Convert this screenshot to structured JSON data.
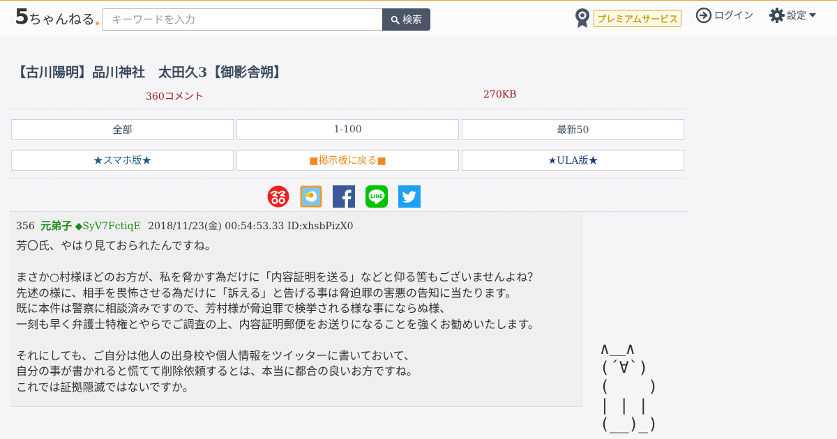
{
  "header": {
    "logo_five": "5",
    "logo_rest": "ちゃんねる",
    "search_placeholder": "キーワードを入力",
    "search_button": "検索",
    "premium": "プレミアムサービス",
    "login": "ログイン",
    "settings": "設定"
  },
  "thread": {
    "title": "【古川陽明】品川神社　太田久3【御影舎朔】",
    "comments": "360コメント",
    "size": "270KB"
  },
  "nav_buttons": [
    {
      "label": "全部",
      "color": "#3c4a5e"
    },
    {
      "label": "1-100",
      "color": "#3c4a5e"
    },
    {
      "label": "最新50",
      "color": "#3c4a5e"
    }
  ],
  "link_buttons": [
    {
      "label": "★スマホ版★",
      "color": "#1f5e8c"
    },
    {
      "label": "■掲示板に戻る■",
      "color": "#f0891a"
    },
    {
      "label": "★ULA版★",
      "color": "#1f3f7a"
    }
  ],
  "share_icons": [
    "zzz-icon",
    "gift-icon",
    "facebook-icon",
    "line-icon",
    "twitter-icon"
  ],
  "post": {
    "number": "356",
    "name": "元弟子",
    "trip": "◆SyV7FctiqE",
    "date": "2018/11/23(金) 00:54:53.33",
    "id": "ID:xhsbPizX0",
    "body": "芳〇氏、やはり見ておられたんですね。\n\nまさか○村様ほどのお方が、私を脅かす為だけに「内容証明を送る」などと仰る筈もございませんよね？\n先述の様に、相手を畏怖させる為だけに「訴える」と告げる事は脅迫罪の害悪の告知に当たります。\n既に本件は警察に相談済みですので、芳村様が脅迫罪で検挙される様な事にならぬ様、\n一刻も早く弁護士特権とやらでご調査の上、内容証明郵便をお送りになることを強くお勧めいたします。\n\nそれにしても、ご自分は他人の出身校や個人情報をツイッターに書いておいて、\n自分の事が書かれると慌てて削除依頼するとは、本当に都合の良いお方ですね。\nこれでは証拠隠滅ではないですか。"
  },
  "ascii_art": "∧＿∧\n(´∀`)\n(    )\n| | |\n(__)_)"
}
